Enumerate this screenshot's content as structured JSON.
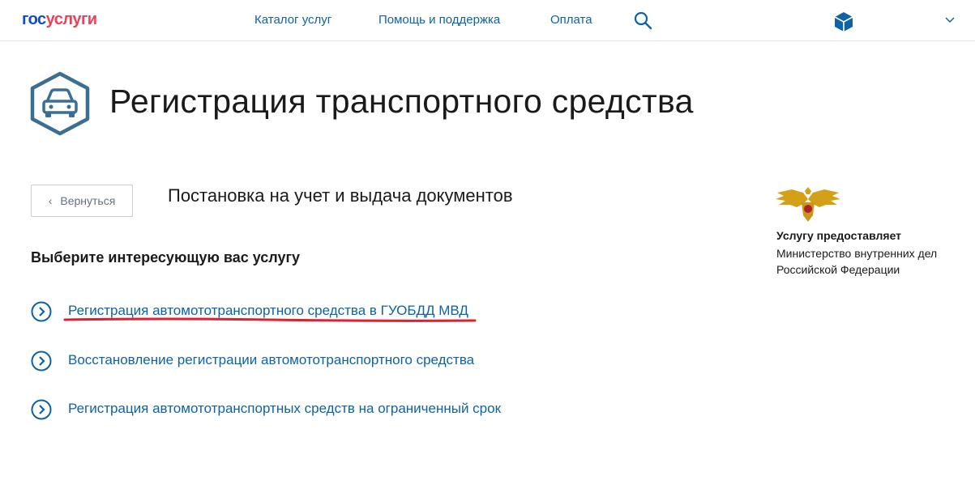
{
  "header": {
    "logo_part1": "гос",
    "logo_part2": "услуги",
    "nav": [
      "Каталог услуг",
      "Помощь и поддержка",
      "Оплата"
    ]
  },
  "page": {
    "title": "Регистрация транспортного средства",
    "back_label": "Вернуться",
    "subtitle": "Постановка на учет и выдача документов",
    "choose_label": "Выберите интересующую вас услугу"
  },
  "services": [
    "Регистрация автомототранспортного средства в ГУОБДД МВД",
    "Восстановление регистрации автомототранспортного средства",
    "Регистрация автомототранспортных средств на ограниченный срок"
  ],
  "provider": {
    "label": "Услугу предоставляет",
    "name": "Министерство внутренних дел Российской Федерации"
  },
  "colors": {
    "brand_blue": "#0d4cd3",
    "brand_red": "#ee3f58",
    "link": "#0d63a5",
    "icon_blue": "#3a6e95",
    "annotation_red": "#e0202e"
  }
}
